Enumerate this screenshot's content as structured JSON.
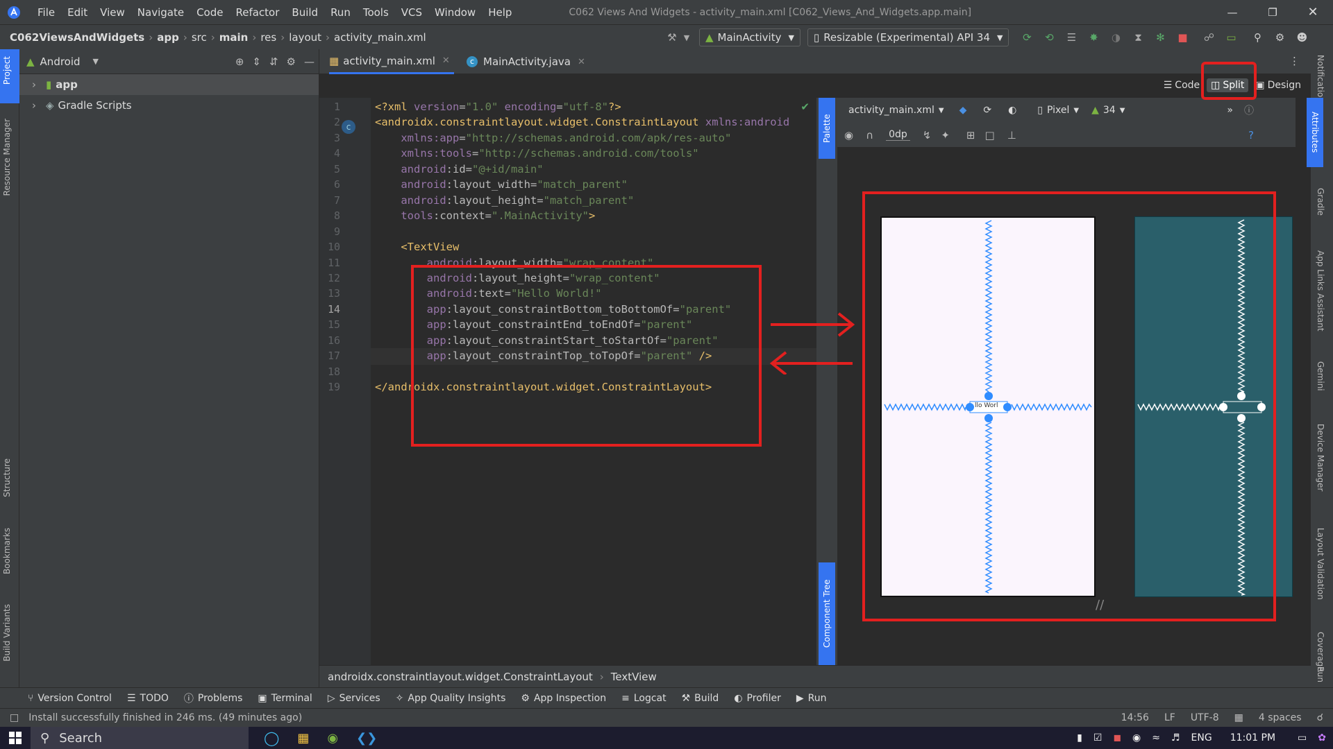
{
  "title_bar": {
    "menus": [
      "File",
      "Edit",
      "View",
      "Navigate",
      "Code",
      "Refactor",
      "Build",
      "Run",
      "Tools",
      "VCS",
      "Window",
      "Help"
    ],
    "window_title": "C062 Views And Widgets - activity_main.xml [C062_Views_And_Widgets.app.main]"
  },
  "breadcrumb": [
    "C062ViewsAndWidgets",
    "app",
    "src",
    "main",
    "res",
    "layout",
    "activity_main.xml"
  ],
  "toolbar": {
    "run_config": "MainActivity",
    "device": "Resizable (Experimental) API 34"
  },
  "project_panel": {
    "view": "Android",
    "items": [
      "app",
      "Gradle Scripts"
    ]
  },
  "left_tabs": [
    "Project",
    "Resource Manager",
    "Structure",
    "Bookmarks",
    "Build Variants"
  ],
  "file_tabs": [
    {
      "label": "activity_main.xml",
      "active": true
    },
    {
      "label": "MainActivity.java",
      "active": false
    }
  ],
  "view_modes": {
    "code": "Code",
    "split": "Split",
    "design": "Design"
  },
  "code_lines": [
    [
      [
        "<?",
        "pu"
      ],
      [
        "xml ",
        "kw"
      ],
      [
        "version",
        "at"
      ],
      [
        "=",
        "ns"
      ],
      [
        "\"1.0\" ",
        "vl"
      ],
      [
        "encoding",
        "at"
      ],
      [
        "=",
        "ns"
      ],
      [
        "\"utf-8\"",
        "vl"
      ],
      [
        "?>",
        "pu"
      ]
    ],
    [
      [
        "<androidx.constraintlayout.widget.ConstraintLayout ",
        "kw"
      ],
      [
        "xmlns:",
        "at"
      ],
      [
        "android",
        "at"
      ]
    ],
    [
      [
        "    xmlns:",
        "at"
      ],
      [
        "app",
        "at"
      ],
      [
        "=",
        "ns"
      ],
      [
        "\"http://schemas.android.com/apk/res-auto\"",
        "vl"
      ]
    ],
    [
      [
        "    xmlns:",
        "at"
      ],
      [
        "tools",
        "at"
      ],
      [
        "=",
        "ns"
      ],
      [
        "\"http://schemas.android.com/tools\"",
        "vl"
      ]
    ],
    [
      [
        "    android",
        "at"
      ],
      [
        ":id=",
        "ns"
      ],
      [
        "\"@+id/main\"",
        "vl"
      ]
    ],
    [
      [
        "    android",
        "at"
      ],
      [
        ":layout_width=",
        "ns"
      ],
      [
        "\"match_parent\"",
        "vl"
      ]
    ],
    [
      [
        "    android",
        "at"
      ],
      [
        ":layout_height=",
        "ns"
      ],
      [
        "\"match_parent\"",
        "vl"
      ]
    ],
    [
      [
        "    tools",
        "at"
      ],
      [
        ":context=",
        "ns"
      ],
      [
        "\".MainActivity\"",
        "vl"
      ],
      [
        ">",
        "kw"
      ]
    ],
    [
      [
        "",
        ""
      ]
    ],
    [
      [
        "    <TextView",
        "kw"
      ]
    ],
    [
      [
        "        android",
        "at"
      ],
      [
        ":layout_width=",
        "ns"
      ],
      [
        "\"wrap_content\"",
        "vl"
      ]
    ],
    [
      [
        "        android",
        "at"
      ],
      [
        ":layout_height=",
        "ns"
      ],
      [
        "\"wrap_content\"",
        "vl"
      ]
    ],
    [
      [
        "        android",
        "at"
      ],
      [
        ":text=",
        "ns"
      ],
      [
        "\"Hello World!\"",
        "vl"
      ]
    ],
    [
      [
        "        app",
        "at"
      ],
      [
        ":layout_constraintBottom_toBottomOf=",
        "ns"
      ],
      [
        "\"parent\"",
        "vl"
      ]
    ],
    [
      [
        "        app",
        "at"
      ],
      [
        ":layout_constraintEnd_toEndOf=",
        "ns"
      ],
      [
        "\"parent\"",
        "vl"
      ]
    ],
    [
      [
        "        app",
        "at"
      ],
      [
        ":layout_constraintStart_toStartOf=",
        "ns"
      ],
      [
        "\"parent\"",
        "vl"
      ]
    ],
    [
      [
        "        app",
        "at"
      ],
      [
        ":layout_constraintTop_toTopOf=",
        "ns"
      ],
      [
        "\"parent\" ",
        "vl"
      ],
      [
        "/>",
        "kw"
      ]
    ],
    [
      [
        "",
        ""
      ]
    ],
    [
      [
        "</androidx.constraintlayout.widget.ConstraintLayout>",
        "kw"
      ]
    ]
  ],
  "current_line": 14,
  "design_toolbar": {
    "file": "activity_main.xml",
    "device": "Pixel",
    "api": "34",
    "margin": "0dp"
  },
  "preview_text": "Hello World!",
  "preview_text_visible": "llo Worl",
  "side_tabs": {
    "palette": "Palette",
    "component_tree": "Component Tree",
    "attributes": "Attributes"
  },
  "right_tabs": [
    "Notifications",
    "Gradle",
    "App Links Assistant",
    "Gemini",
    "Device Manager",
    "Layout Validation",
    "Coverage",
    "Run"
  ],
  "editor_breadcrumb": [
    "androidx.constraintlayout.widget.ConstraintLayout",
    "TextView"
  ],
  "tool_windows": [
    "Version Control",
    "TODO",
    "Problems",
    "Terminal",
    "Services",
    "App Quality Insights",
    "App Inspection",
    "Logcat",
    "Build",
    "Profiler",
    "Run"
  ],
  "status": {
    "message": "Install successfully finished in 246 ms. (49 minutes ago)",
    "position": "14:56",
    "line_sep": "LF",
    "encoding": "UTF-8",
    "indent": "4 spaces"
  },
  "taskbar": {
    "search": "Search",
    "lang": "ENG",
    "time": "11:01 PM"
  },
  "colors": {
    "accent": "#3574f0",
    "annotation": "#e3201f",
    "constraint": "#2f8cff"
  }
}
